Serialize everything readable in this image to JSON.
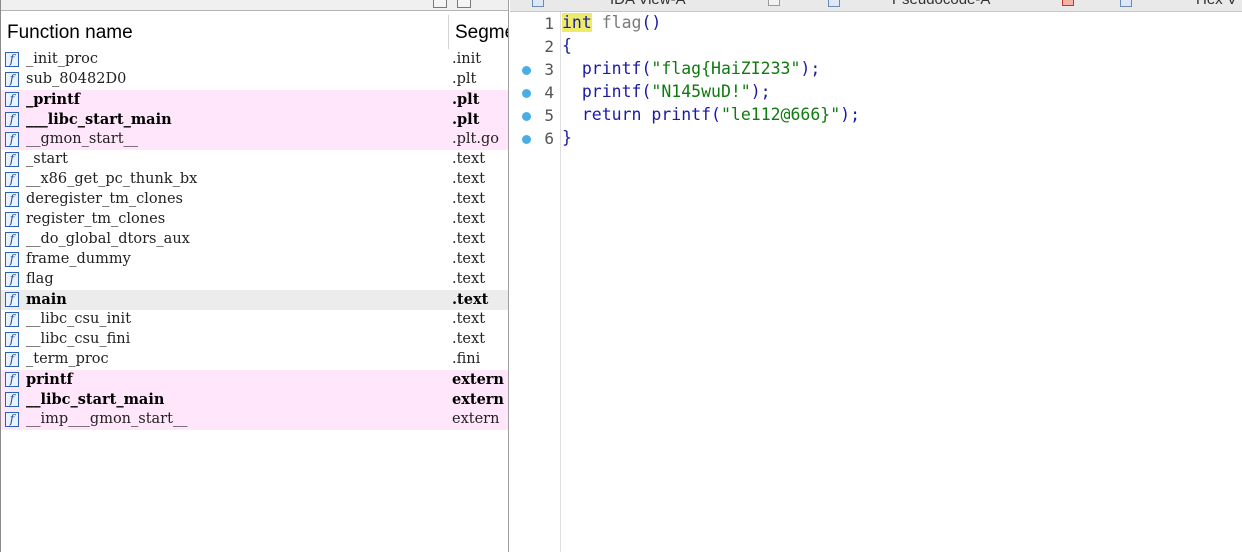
{
  "functions_window": {
    "columns": {
      "function_name": "Function name",
      "segment": "Segme"
    },
    "rows": [
      {
        "name": "_init_proc",
        "segment": ".init",
        "style": "normal"
      },
      {
        "name": "sub_80482D0",
        "segment": ".plt",
        "style": "normal"
      },
      {
        "name": "_printf",
        "segment": ".plt",
        "style": "pink-bold"
      },
      {
        "name": "___libc_start_main",
        "segment": ".plt",
        "style": "pink-bold"
      },
      {
        "name": "__gmon_start__",
        "segment": ".plt.go",
        "style": "pink"
      },
      {
        "name": "_start",
        "segment": ".text",
        "style": "normal"
      },
      {
        "name": "__x86_get_pc_thunk_bx",
        "segment": ".text",
        "style": "normal"
      },
      {
        "name": "deregister_tm_clones",
        "segment": ".text",
        "style": "normal"
      },
      {
        "name": "register_tm_clones",
        "segment": ".text",
        "style": "normal"
      },
      {
        "name": "__do_global_dtors_aux",
        "segment": ".text",
        "style": "normal"
      },
      {
        "name": "frame_dummy",
        "segment": ".text",
        "style": "normal"
      },
      {
        "name": "flag",
        "segment": ".text",
        "style": "normal"
      },
      {
        "name": "main",
        "segment": ".text",
        "style": "selected-bold"
      },
      {
        "name": "__libc_csu_init",
        "segment": ".text",
        "style": "normal"
      },
      {
        "name": "__libc_csu_fini",
        "segment": ".text",
        "style": "normal"
      },
      {
        "name": "_term_proc",
        "segment": ".fini",
        "style": "normal"
      },
      {
        "name": "printf",
        "segment": "extern",
        "style": "pink-bold"
      },
      {
        "name": "__libc_start_main",
        "segment": "extern",
        "style": "pink-bold"
      },
      {
        "name": "__imp___gmon_start__",
        "segment": "extern",
        "style": "pink"
      }
    ]
  },
  "tabs": [
    {
      "label": "IDA View-A"
    },
    {
      "label": "Pseudocode-A"
    },
    {
      "label": "Hex V"
    }
  ],
  "pseudocode": {
    "lines": [
      {
        "no": "1",
        "breakpoint": false,
        "parts": [
          {
            "t": "int",
            "c": "kw-hl"
          },
          {
            "t": " ",
            "c": "kw"
          },
          {
            "t": "flag",
            "c": "ident"
          },
          {
            "t": "()",
            "c": "punct"
          }
        ]
      },
      {
        "no": "2",
        "breakpoint": false,
        "parts": [
          {
            "t": "{",
            "c": "punct"
          }
        ]
      },
      {
        "no": "3",
        "breakpoint": true,
        "parts": [
          {
            "t": "  printf(",
            "c": "kw"
          },
          {
            "t": "\"flag{HaiZI233\"",
            "c": "str"
          },
          {
            "t": ");",
            "c": "punct"
          }
        ]
      },
      {
        "no": "4",
        "breakpoint": true,
        "parts": [
          {
            "t": "  printf(",
            "c": "kw"
          },
          {
            "t": "\"N145wuD!\"",
            "c": "str"
          },
          {
            "t": ");",
            "c": "punct"
          }
        ]
      },
      {
        "no": "5",
        "breakpoint": true,
        "parts": [
          {
            "t": "  return printf(",
            "c": "kw"
          },
          {
            "t": "\"le112@666}\"",
            "c": "str"
          },
          {
            "t": ");",
            "c": "punct"
          }
        ]
      },
      {
        "no": "6",
        "breakpoint": true,
        "parts": [
          {
            "t": "}",
            "c": "punct"
          }
        ]
      }
    ]
  },
  "colors": {
    "pink_row": "#ffe6fb",
    "selected_row": "#ececec",
    "keyword": "#1a1aa6",
    "string": "#0f7a0f",
    "highlight": "#ecec6a",
    "breakpoint": "#4aaee6"
  },
  "icons": {
    "function": "function-f-icon",
    "breakpoint": "breakpoint-dot-icon"
  }
}
